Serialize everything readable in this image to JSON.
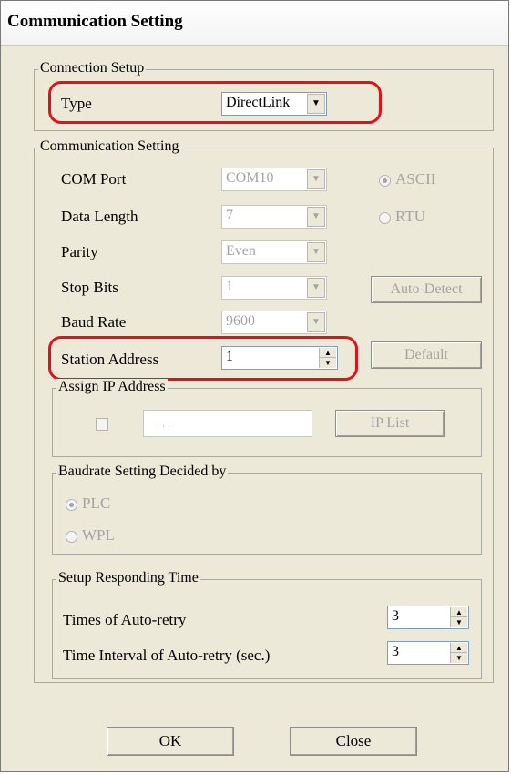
{
  "window": {
    "title": "Communication Setting"
  },
  "connection_setup": {
    "legend": "Connection Setup",
    "type_label": "Type",
    "type_value": "DirectLink"
  },
  "comm_setting": {
    "legend": "Communication Setting",
    "com_port_label": "COM Port",
    "com_port_value": "COM10",
    "data_length_label": "Data Length",
    "data_length_value": "7",
    "parity_label": "Parity",
    "parity_value": "Even",
    "stop_bits_label": "Stop Bits",
    "stop_bits_value": "1",
    "baud_rate_label": "Baud Rate",
    "baud_rate_value": "9600",
    "station_address_label": "Station Address",
    "station_address_value": "1",
    "ascii_label": "ASCII",
    "rtu_label": "RTU",
    "auto_detect_label": "Auto-Detect",
    "default_label": "Default",
    "mode_selected": "ASCII"
  },
  "assign_ip": {
    "legend": "Assign IP Address",
    "ip_value": ". . .",
    "ip_list_label": "IP List",
    "checked": false
  },
  "baudrate_decided": {
    "legend": "Baudrate Setting Decided by",
    "plc_label": "PLC",
    "wpl_label": "WPL",
    "selected": "PLC"
  },
  "responding_time": {
    "legend": "Setup Responding Time",
    "retry_label": "Times of Auto-retry",
    "retry_value": "3",
    "interval_label": "Time Interval of Auto-retry (sec.)",
    "interval_value": "3"
  },
  "footer": {
    "ok_label": "OK",
    "close_label": "Close"
  },
  "colors": {
    "highlight": "#e0121b",
    "dialog_bg": "#ece9d8"
  }
}
